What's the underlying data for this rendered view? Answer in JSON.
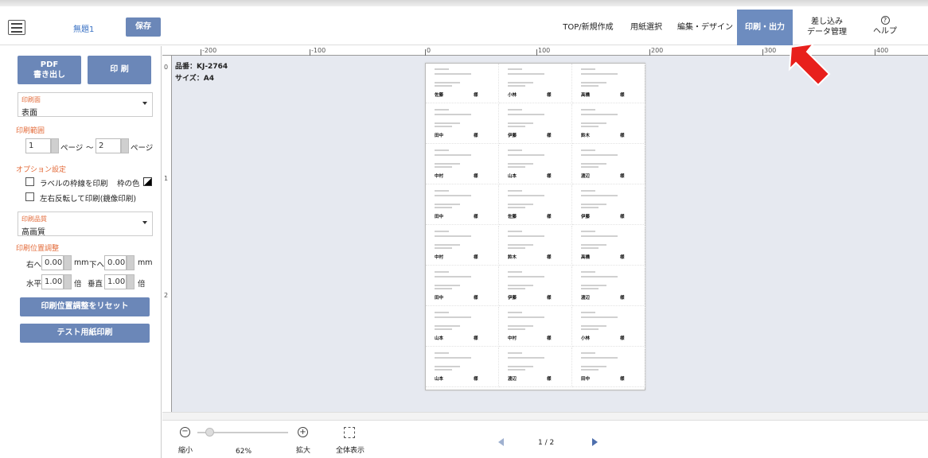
{
  "header": {
    "doc_title": "無題1",
    "save": "保存",
    "nav": [
      "TOP/新規作成",
      "用紙選択",
      "編集・デザイン",
      "印刷・出力"
    ],
    "merge_line1": "差し込み",
    "merge_line2": "データ管理",
    "help": "ヘルプ"
  },
  "sidebar": {
    "pdf_line1": "PDF",
    "pdf_line2": "書き出し",
    "print": "印 刷",
    "print_side_label": "印刷面",
    "print_side_value": "表面",
    "range_title": "印刷範囲",
    "range_from": "1",
    "range_to": "2",
    "page_word": "ページ",
    "range_sep": "～",
    "option_title": "オプション設定",
    "opt_border": "ラベルの枠線を印刷",
    "frame_color": "枠の色",
    "opt_mirror": "左右反転して印刷(鏡像印刷)",
    "quality_label": "印刷品質",
    "quality_value": "高画質",
    "adjust_title": "印刷位置調整",
    "right_label": "右へ",
    "right_value": "0.00",
    "down_label": "下へ",
    "down_value": "0.00",
    "mm": "mm",
    "h_label": "水平",
    "h_value": "1.00",
    "v_label": "垂直",
    "v_value": "1.00",
    "times": "倍",
    "reset": "印刷位置調整をリセット",
    "test": "テスト用紙印刷"
  },
  "canvas": {
    "product": "品番：KJ-2764",
    "size": "サイズ：A4",
    "ruler_h": [
      "-200",
      "-100",
      "0",
      "100",
      "200",
      "300",
      "400"
    ],
    "ruler_v": [
      "0",
      "1",
      "2"
    ]
  },
  "sheet": {
    "honorific": "様",
    "names": [
      "佐藤",
      "小林",
      "高橋",
      "田中",
      "伊藤",
      "鈴木",
      "中村",
      "山本",
      "渡辺",
      "田中",
      "佐藤",
      "伊藤",
      "中村",
      "鈴木",
      "高橋",
      "田中",
      "伊藤",
      "渡辺",
      "山本",
      "中村",
      "小林",
      "山本",
      "渡辺",
      "田中"
    ]
  },
  "footer": {
    "zoom_out": "縮小",
    "zoom_value": "62%",
    "zoom_in": "拡大",
    "fit": "全体表示",
    "pager": "1 / 2"
  },
  "colors": {
    "accent": "#6b87b8",
    "active_nav": "#6d8cbf",
    "section": "#e36b3a",
    "arrow": "#e8201c"
  }
}
